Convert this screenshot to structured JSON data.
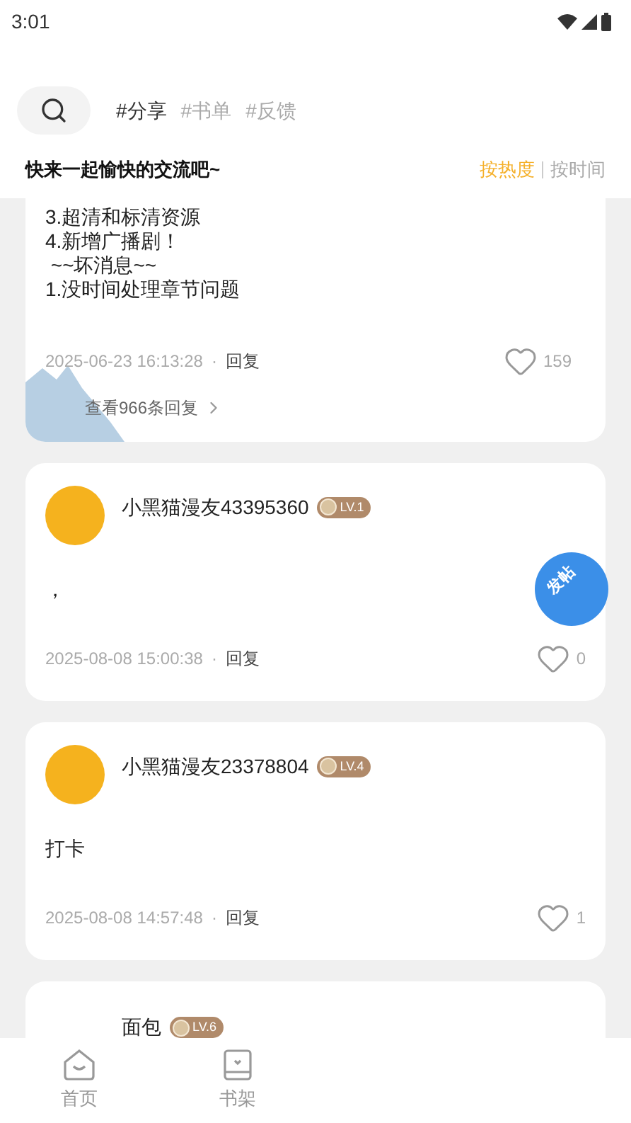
{
  "status_bar": {
    "time": "3:01"
  },
  "tags": [
    {
      "label": "#分享",
      "selected": true
    },
    {
      "label": "#书单",
      "selected": false
    },
    {
      "label": "#反馈",
      "selected": false
    }
  ],
  "header": {
    "title": "快来一起愉快的交流吧~",
    "sort": [
      {
        "label": "按热度",
        "selected": true
      },
      {
        "label": "按时间",
        "selected": false
      }
    ]
  },
  "posts": [
    {
      "kind": "partial",
      "lines": [
        "3.超清和标清资源",
        "4.新增广播剧！",
        " ~~坏消息~~",
        "1.没时间处理章节问题"
      ],
      "date": "2025-06-23 16:13:28",
      "separator": "·",
      "reply": "回复",
      "likes": "159",
      "replies_link": "查看966条回复"
    },
    {
      "kind": "full",
      "user": "小黑猫漫友43395360",
      "level": "LV.1",
      "text": "，",
      "date": "2025-08-08 15:00:38",
      "separator": "·",
      "reply": "回复",
      "likes": "0"
    },
    {
      "kind": "full",
      "user": "小黑猫漫友23378804",
      "level": "LV.4",
      "text": "打卡",
      "date": "2025-08-08 14:57:48",
      "separator": "·",
      "reply": "回复",
      "likes": "1"
    },
    {
      "kind": "head",
      "user": "面包",
      "level": "LV.6"
    }
  ],
  "fab": {
    "label": "发帖"
  },
  "nav": [
    {
      "label": "首页"
    },
    {
      "label": "书架"
    }
  ]
}
